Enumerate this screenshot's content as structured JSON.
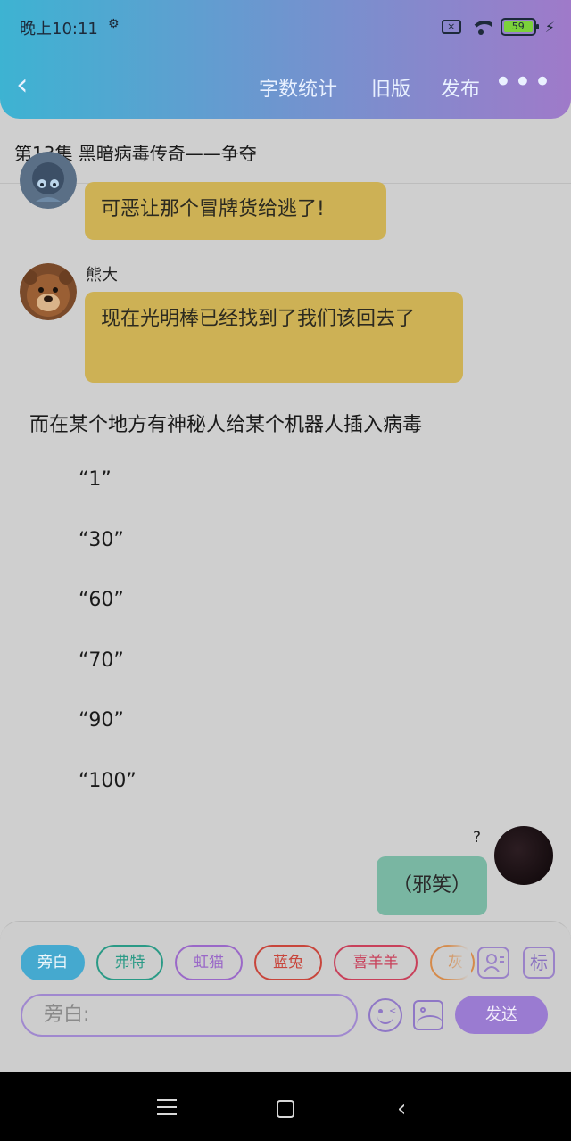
{
  "status_bar": {
    "time": "晚上10:11",
    "settings_glyph": "⚙",
    "battery": "59",
    "icons": [
      "close-box-icon",
      "wifi-icon",
      "battery-icon",
      "charging-bolt-icon"
    ]
  },
  "header": {
    "back_glyph": "‹",
    "actions": [
      "字数统计",
      "旧版",
      "发布"
    ],
    "more_glyph": "•••"
  },
  "episode_title": "第13集  黑暗病毒传奇——争夺",
  "messages": [
    {
      "speaker": "",
      "text": "可恶让那个冒牌货给逃了!"
    },
    {
      "speaker": "熊大",
      "text": "现在光明棒已经找到了我们该回去了"
    }
  ],
  "narration": "而在某个地方有神秘人给某个机器人插入病毒",
  "countdown": [
    "“1”",
    "“30”",
    "“60”",
    "“70”",
    "“90”",
    "“100”"
  ],
  "right_message": {
    "speaker": "?",
    "text": "（邪笑）"
  },
  "characters": [
    {
      "label": "旁白",
      "color": "#45a9cf"
    },
    {
      "label": "弗特",
      "color": "#2a9a86"
    },
    {
      "label": "虹猫",
      "color": "#9a68c8"
    },
    {
      "label": "蓝兔",
      "color": "#c8453b"
    },
    {
      "label": "喜羊羊",
      "color": "#c8405a"
    },
    {
      "label": "灰",
      "color": "#d58a4a"
    }
  ],
  "toolbar": {
    "role_button": "role-icon",
    "mark_label": "标",
    "input_placeholder": "旁白:",
    "send_label": "发送"
  },
  "nav_bar": {
    "back_glyph": "‹"
  }
}
